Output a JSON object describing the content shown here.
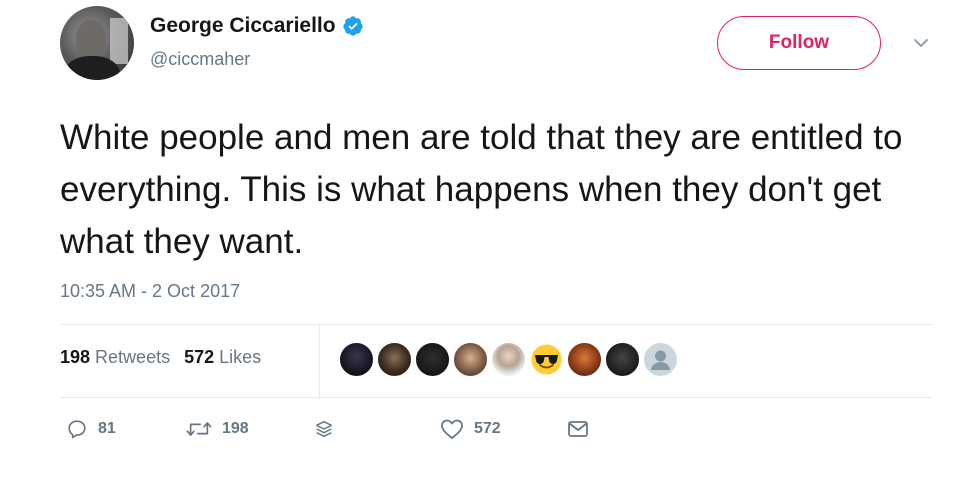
{
  "user": {
    "display_name": "George Ciccariello",
    "handle": "@ciccmaher",
    "verified": true
  },
  "follow_label": "Follow",
  "tweet": {
    "text": "White people and men are told that they are entitled to everything. This is what happens when they don't get what they want.",
    "timestamp": "10:35 AM - 2 Oct 2017"
  },
  "stats": {
    "retweets_count": "198",
    "retweets_label": "Retweets",
    "likes_count": "572",
    "likes_label": "Likes"
  },
  "actions": {
    "reply_count": "81",
    "retweet_count": "198",
    "like_count": "572"
  },
  "colors": {
    "accent": "#e0245e",
    "verified": "#1da1f2",
    "muted": "#657786"
  }
}
